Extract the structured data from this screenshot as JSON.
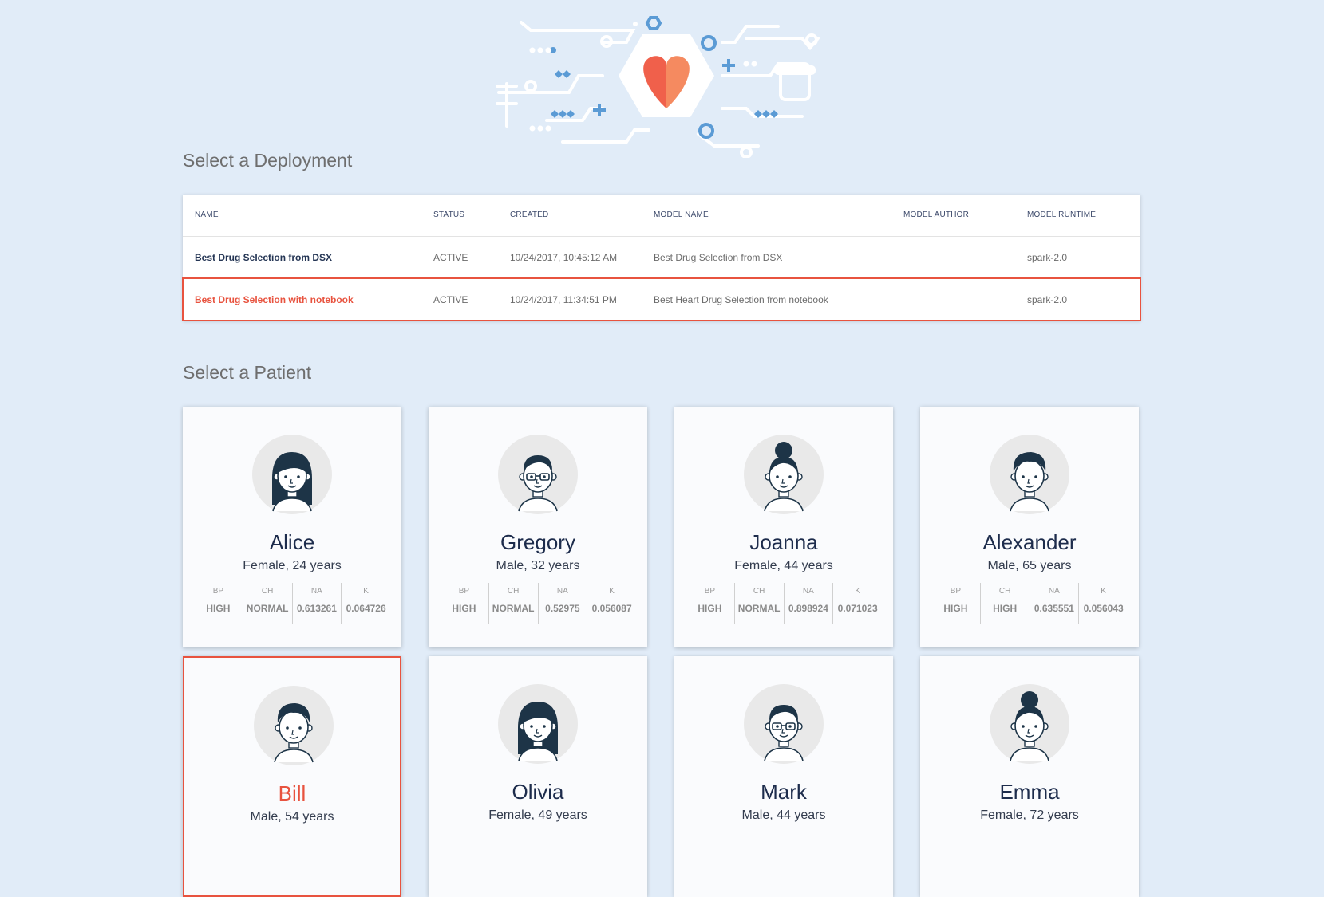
{
  "headings": {
    "deployment": "Select a Deployment",
    "patient": "Select a Patient"
  },
  "deployments": {
    "columns": [
      "NAME",
      "STATUS",
      "CREATED",
      "MODEL NAME",
      "MODEL AUTHOR",
      "MODEL RUNTIME"
    ],
    "rows": [
      {
        "name": "Best Drug Selection from DSX",
        "status": "ACTIVE",
        "created": "10/24/2017, 10:45:12 AM",
        "model_name": "Best Drug Selection from DSX",
        "model_author": "",
        "runtime": "spark-2.0",
        "selected": false
      },
      {
        "name": "Best Drug Selection with notebook",
        "status": "ACTIVE",
        "created": "10/24/2017, 11:34:51 PM",
        "model_name": "Best Heart Drug Selection from notebook",
        "model_author": "",
        "runtime": "spark-2.0",
        "selected": true
      }
    ]
  },
  "stat_labels": [
    "BP",
    "CH",
    "NA",
    "K"
  ],
  "patients": [
    {
      "name": "Alice",
      "info": "Female, 24 years",
      "avatar": "female-long-hair-avatar",
      "stats": [
        "HIGH",
        "NORMAL",
        "0.613261",
        "0.064726"
      ],
      "selected": false
    },
    {
      "name": "Gregory",
      "info": "Male, 32 years",
      "avatar": "male-glasses-avatar",
      "stats": [
        "HIGH",
        "NORMAL",
        "0.52975",
        "0.056087"
      ],
      "selected": false
    },
    {
      "name": "Joanna",
      "info": "Female, 44 years",
      "avatar": "female-bun-avatar",
      "stats": [
        "HIGH",
        "NORMAL",
        "0.898924",
        "0.071023"
      ],
      "selected": false
    },
    {
      "name": "Alexander",
      "info": "Male, 65 years",
      "avatar": "male-hair-avatar",
      "stats": [
        "HIGH",
        "HIGH",
        "0.635551",
        "0.056043"
      ],
      "selected": false
    },
    {
      "name": "Bill",
      "info": "Male, 54 years",
      "avatar": "male-hair-avatar",
      "stats": [],
      "selected": true
    },
    {
      "name": "Olivia",
      "info": "Female, 49 years",
      "avatar": "female-long-hair-avatar",
      "stats": [],
      "selected": false
    },
    {
      "name": "Mark",
      "info": "Male, 44 years",
      "avatar": "male-glasses-avatar",
      "stats": [],
      "selected": false
    },
    {
      "name": "Emma",
      "info": "Female, 72 years",
      "avatar": "female-bun-avatar",
      "stats": [],
      "selected": false
    }
  ],
  "colors": {
    "background": "#e1ecf8",
    "accent": "#e8533f",
    "heart_left": "#f0604b",
    "heart_right": "#f58a60",
    "illustration_blue": "#5b9bd5",
    "avatar_dark": "#1d3447"
  },
  "icons": {
    "hero": "heart-circuit-illustration"
  }
}
